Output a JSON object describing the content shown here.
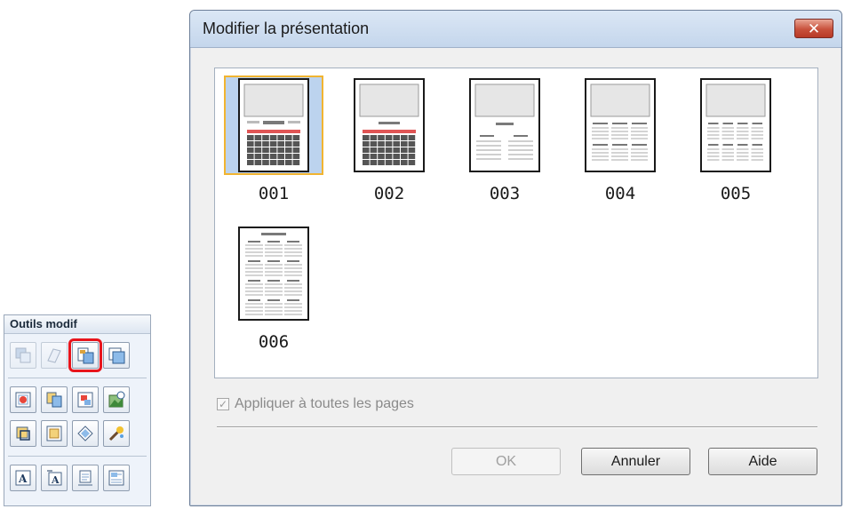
{
  "palette": {
    "title": "Outils modif",
    "rows": [
      [
        "send-backward-icon",
        "bring-forward-icon",
        "change-layout-icon",
        "change-background-icon"
      ],
      [
        "add-image-icon",
        "swap-image-icon",
        "image-position-icon",
        "correct-image-icon"
      ],
      [
        "crop-icon",
        "frame-icon",
        "rotate-icon",
        "effects-icon"
      ],
      [
        "add-text-icon",
        "vertical-text-icon",
        "date-icon",
        "calendar-settings-icon"
      ]
    ],
    "disabled": [
      "send-backward-icon",
      "bring-forward-icon"
    ],
    "highlighted": "change-layout-icon"
  },
  "dialog": {
    "title": "Modifier la présentation",
    "close_glyph": "✕",
    "layouts": [
      {
        "id": "001",
        "style": "full-grid"
      },
      {
        "id": "002",
        "style": "full-grid-header"
      },
      {
        "id": "003",
        "style": "two-columns"
      },
      {
        "id": "004",
        "style": "three-by-two"
      },
      {
        "id": "005",
        "style": "four-by-two"
      },
      {
        "id": "006",
        "style": "full-year"
      }
    ],
    "selected_layout": "001",
    "apply_all_label": "Appliquer à toutes les pages",
    "apply_all_checked": true,
    "ok_label": "OK",
    "cancel_label": "Annuler",
    "help_label": "Aide"
  }
}
